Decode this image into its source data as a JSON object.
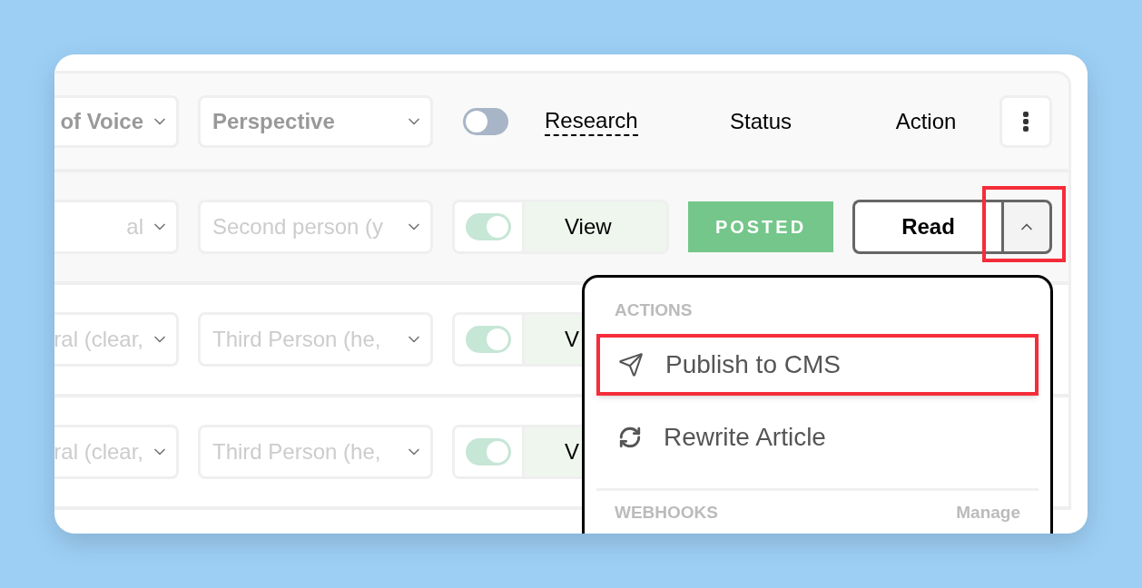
{
  "header": {
    "tone_select": "of Voice",
    "perspective_select": "Perspective",
    "research_toggle_on": false,
    "columns": [
      "Research",
      "Status",
      "Action"
    ]
  },
  "rows": [
    {
      "tone": "al",
      "perspective": "Second person (y",
      "research_on": true,
      "view": "View",
      "status": "POSTED",
      "action": "Read",
      "menu_open": true,
      "annotated": true
    },
    {
      "tone": "ral (clear,",
      "perspective": "Third Person (he,",
      "research_on": true,
      "view": "V"
    },
    {
      "tone": "ral (clear,",
      "perspective": "Third Person (he,",
      "research_on": true,
      "view": "V"
    }
  ],
  "menu": {
    "sections": [
      {
        "title": "ACTIONS",
        "items": [
          {
            "label": "Publish to CMS",
            "kind": "send",
            "highlighted": true
          },
          {
            "label": "Rewrite Article",
            "kind": "refresh",
            "highlighted": false
          }
        ]
      },
      {
        "title": "WEBHOOKS",
        "link": "Manage"
      }
    ]
  }
}
